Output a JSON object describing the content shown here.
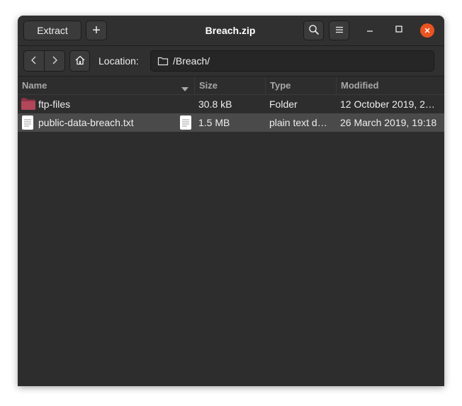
{
  "window": {
    "title": "Breach.zip"
  },
  "header": {
    "extract_label": "Extract",
    "add_label": "+"
  },
  "location": {
    "label": "Location:",
    "path": "/Breach/"
  },
  "columns": {
    "name": "Name",
    "size": "Size",
    "type": "Type",
    "modified": "Modified"
  },
  "files": [
    {
      "name": "ftp-files",
      "size": "30.8 kB",
      "type": "Folder",
      "modified": "12 October 2019, 2…",
      "icon": "folder-icon"
    },
    {
      "name": "public-data-breach.txt",
      "size": "1.5 MB",
      "type": "plain text d…",
      "modified": "26 March 2019, 19:18",
      "icon": "text-file-icon"
    }
  ],
  "colors": {
    "accent": "#e95420",
    "folder": "#b3475a",
    "background": "#2d2d2d",
    "selected_row": "#4a4a4a"
  }
}
